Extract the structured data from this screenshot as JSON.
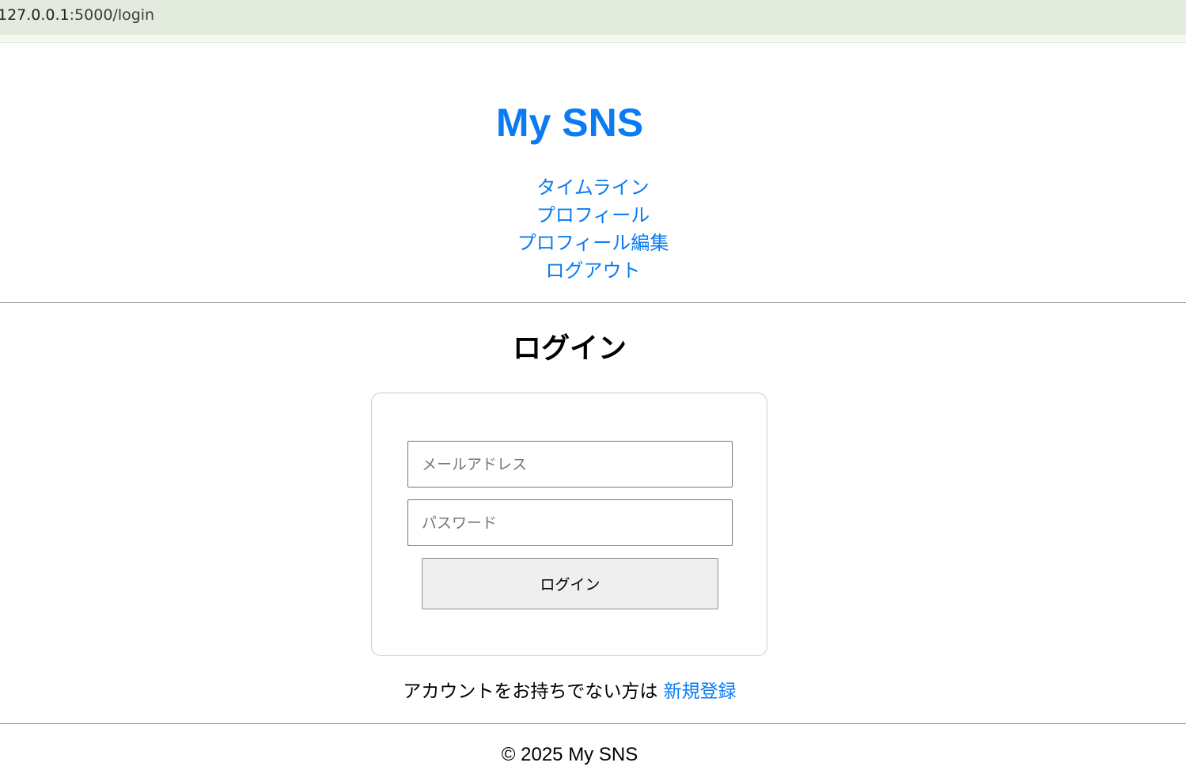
{
  "browser": {
    "url_host": "127.0.0.1",
    "url_path": ":5000/login"
  },
  "header": {
    "site_title": "My SNS",
    "nav": [
      {
        "label": "タイムライン"
      },
      {
        "label": "プロフィール"
      },
      {
        "label": "プロフィール編集"
      },
      {
        "label": "ログアウト"
      }
    ]
  },
  "main": {
    "title": "ログイン",
    "form": {
      "email_placeholder": "メールアドレス",
      "email_value": "",
      "password_placeholder": "パスワード",
      "password_value": "",
      "submit_label": "ログイン"
    },
    "signup_prompt": "アカウントをお持ちでない方は",
    "signup_link": "新規登録"
  },
  "footer": {
    "text": "© 2025 My SNS"
  },
  "colors": {
    "link": "#0a7bf2",
    "urlbar": "#e3ebde"
  }
}
